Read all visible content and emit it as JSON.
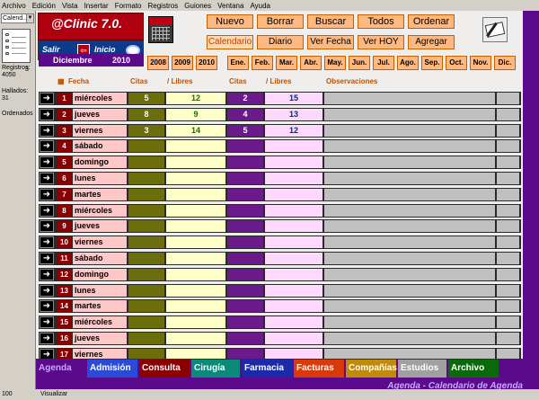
{
  "menu": [
    "Archivo",
    "Edición",
    "Vista",
    "Insertar",
    "Formato",
    "Registros",
    "Guiones",
    "Ventana",
    "Ayuda"
  ],
  "left": {
    "layout_value": "Calend...",
    "book_count": "3",
    "registros_label": "Registros:",
    "registros_value": "4050",
    "hallados_label": "Hallados:",
    "hallados_value": "31",
    "sort_status": "Ordenados"
  },
  "logo": {
    "title": "@Clinic 7.0.",
    "salir": "Salir",
    "inicio": "Inicio"
  },
  "nav_row1": [
    "Nuevo",
    "Borrar",
    "Buscar",
    "Todos",
    "Ordenar"
  ],
  "nav_row2": [
    "Calendario",
    "Diario",
    "Ver Fecha",
    "Ver HOY",
    "Agregar"
  ],
  "month_bar": {
    "month": "Diciembre",
    "year": "2010"
  },
  "years": [
    "2008",
    "2009",
    "2010"
  ],
  "months": [
    "Ene.",
    "Feb.",
    "Mar.",
    "Abr.",
    "May.",
    "Jun.",
    "Jul.",
    "Ago.",
    "Sep.",
    "Oct.",
    "Nov.",
    "Dic."
  ],
  "headers": {
    "fecha": "Fecha",
    "citas1": "Citas",
    "libres1": "/ Libres",
    "citas2": "Citas",
    "libres2": "/ Libres",
    "obs": "Observaciones"
  },
  "rows": [
    {
      "num": "1",
      "day": "miércoles",
      "citas1": "5",
      "libres1": "12",
      "citas2": "2",
      "libres2": "15"
    },
    {
      "num": "2",
      "day": "jueves",
      "citas1": "8",
      "libres1": "9",
      "citas2": "4",
      "libres2": "13"
    },
    {
      "num": "3",
      "day": "viernes",
      "citas1": "3",
      "libres1": "14",
      "citas2": "5",
      "libres2": "12"
    },
    {
      "num": "4",
      "day": "sábado",
      "citas1": "",
      "libres1": "",
      "citas2": "",
      "libres2": ""
    },
    {
      "num": "5",
      "day": "domingo",
      "citas1": "",
      "libres1": "",
      "citas2": "",
      "libres2": ""
    },
    {
      "num": "6",
      "day": "lunes",
      "citas1": "",
      "libres1": "",
      "citas2": "",
      "libres2": ""
    },
    {
      "num": "7",
      "day": "martes",
      "citas1": "",
      "libres1": "",
      "citas2": "",
      "libres2": ""
    },
    {
      "num": "8",
      "day": "miércoles",
      "citas1": "",
      "libres1": "",
      "citas2": "",
      "libres2": ""
    },
    {
      "num": "9",
      "day": "jueves",
      "citas1": "",
      "libres1": "",
      "citas2": "",
      "libres2": ""
    },
    {
      "num": "10",
      "day": "viernes",
      "citas1": "",
      "libres1": "",
      "citas2": "",
      "libres2": ""
    },
    {
      "num": "11",
      "day": "sábado",
      "citas1": "",
      "libres1": "",
      "citas2": "",
      "libres2": ""
    },
    {
      "num": "12",
      "day": "domingo",
      "citas1": "",
      "libres1": "",
      "citas2": "",
      "libres2": ""
    },
    {
      "num": "13",
      "day": "lunes",
      "citas1": "",
      "libres1": "",
      "citas2": "",
      "libres2": ""
    },
    {
      "num": "14",
      "day": "martes",
      "citas1": "",
      "libres1": "",
      "citas2": "",
      "libres2": ""
    },
    {
      "num": "15",
      "day": "miércoles",
      "citas1": "",
      "libres1": "",
      "citas2": "",
      "libres2": ""
    },
    {
      "num": "16",
      "day": "jueves",
      "citas1": "",
      "libres1": "",
      "citas2": "",
      "libres2": ""
    },
    {
      "num": "17",
      "day": "viernes",
      "citas1": "",
      "libres1": "",
      "citas2": "",
      "libres2": ""
    }
  ],
  "tabs": [
    {
      "label": "Agenda",
      "color": "#5a0a8a",
      "text": "#c8a8ff"
    },
    {
      "label": "Admisión",
      "color": "#2a4ad8",
      "text": "#ffffff"
    },
    {
      "label": "Consulta",
      "color": "#8a0000",
      "text": "#ffffff"
    },
    {
      "label": "Cirugía",
      "color": "#0a8a7a",
      "text": "#ffffff"
    },
    {
      "label": "Farmacia",
      "color": "#1a2aa8",
      "text": "#ffffff"
    },
    {
      "label": "Facturas",
      "color": "#d83a0a",
      "text": "#ffffff"
    },
    {
      "label": "Compañías",
      "color": "#c08a0a",
      "text": "#ffffff"
    },
    {
      "label": "Estudios",
      "color": "#a0a0a0",
      "text": "#ffffff"
    },
    {
      "label": "Archivo",
      "color": "#0a6a0a",
      "text": "#ffffff"
    }
  ],
  "footer": "Agenda - Calendario de Agenda",
  "status": {
    "zoom": "100",
    "mode": "Visualizar"
  }
}
